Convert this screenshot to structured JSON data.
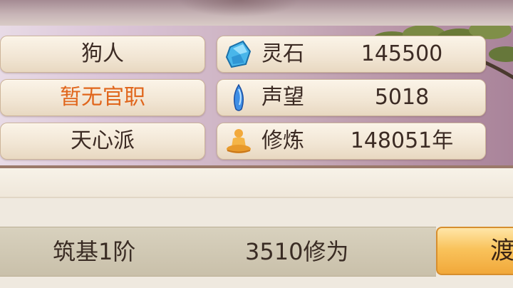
{
  "profile": {
    "name": "狗人",
    "official_title": "暂无官职",
    "sect": "天心派"
  },
  "attributes": [
    {
      "icon": "spirit-stone-icon",
      "label": "灵石",
      "value": "145500"
    },
    {
      "icon": "prestige-icon",
      "label": "声望",
      "value": "5018"
    },
    {
      "icon": "cultivation-icon",
      "label": "修炼",
      "value": "148051年"
    }
  ],
  "realm": {
    "level": "筑基1阶",
    "cultivation_points": "3510修为"
  },
  "action_button": {
    "label": "渡"
  },
  "colors": {
    "title_orange": "#e0661c",
    "button_gold": "#f9c35c",
    "panel_purple": "#c9aebc"
  }
}
